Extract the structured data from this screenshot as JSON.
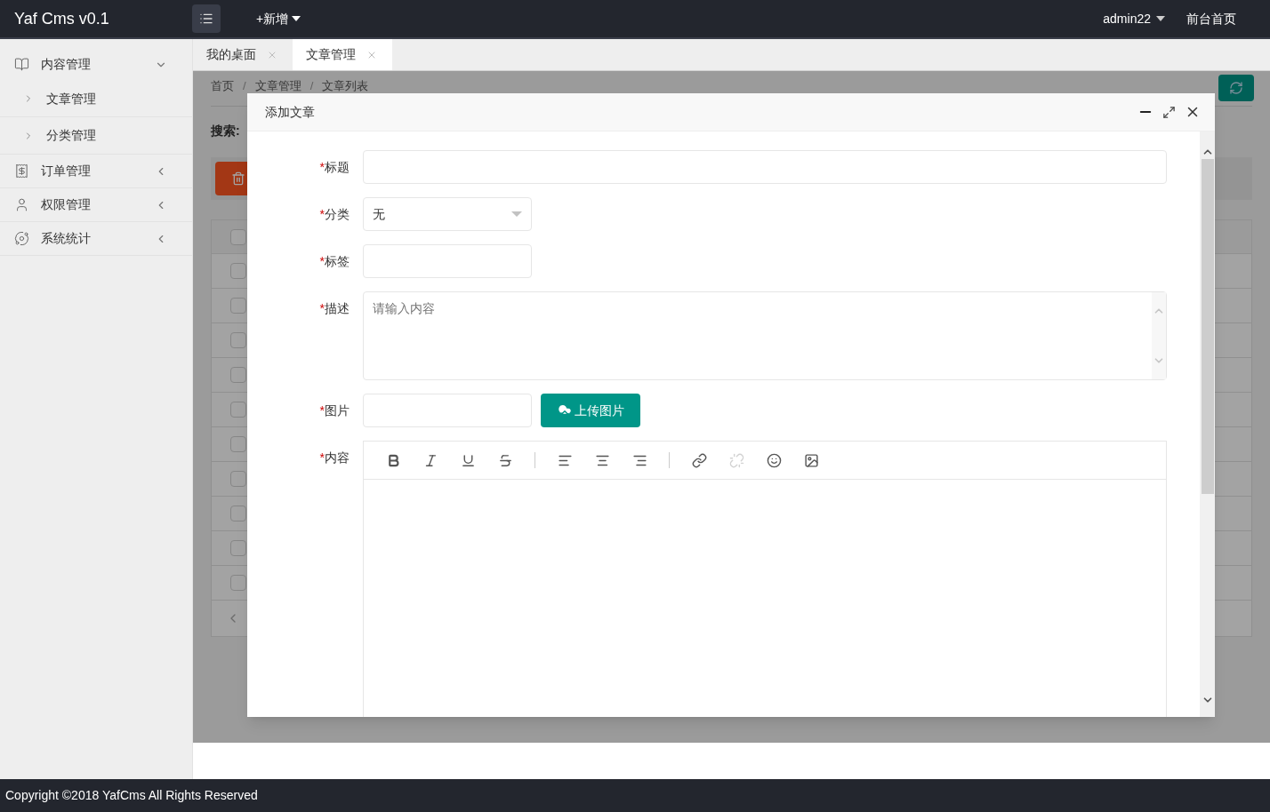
{
  "header": {
    "logo": "Yaf Cms v0.1",
    "new_menu": "+新增",
    "user": "admin22",
    "home_link": "前台首页"
  },
  "sidebar": {
    "items": [
      {
        "label": "内容管理",
        "expanded": true,
        "children": [
          {
            "label": "文章管理"
          },
          {
            "label": "分类管理"
          }
        ]
      },
      {
        "label": "订单管理",
        "expanded": false
      },
      {
        "label": "权限管理",
        "expanded": false
      },
      {
        "label": "系统统计",
        "expanded": false
      }
    ]
  },
  "tabs": [
    {
      "label": "我的桌面",
      "selected": false
    },
    {
      "label": "文章管理",
      "selected": true
    }
  ],
  "page": {
    "breadcrumb": [
      {
        "kind": "link",
        "text": "首页"
      },
      {
        "kind": "sep",
        "text": "/"
      },
      {
        "kind": "link",
        "text": "文章管理"
      },
      {
        "kind": "sep",
        "text": "/"
      },
      {
        "kind": "link",
        "text": "文章列表"
      }
    ],
    "search_label": "搜索:",
    "table": {
      "header_checked": false,
      "rows": [
        {
          "checked": false
        },
        {
          "checked": false
        },
        {
          "checked": false
        },
        {
          "checked": false
        },
        {
          "checked": false
        },
        {
          "checked": false
        },
        {
          "checked": false
        },
        {
          "checked": false
        },
        {
          "checked": false
        },
        {
          "checked": false
        }
      ]
    }
  },
  "dialog": {
    "title": "添加文章",
    "fields": [
      {
        "kind": "text",
        "label": "标题",
        "required_mark": "*"
      },
      {
        "kind": "select",
        "label": "分类",
        "required_mark": "*",
        "value": "无"
      },
      {
        "kind": "short",
        "label": "标签",
        "required_mark": "*"
      },
      {
        "kind": "textarea",
        "label": "描述",
        "required_mark": "*",
        "placeholder": "请输入内容"
      },
      {
        "kind": "upload",
        "label": "图片",
        "required_mark": "*",
        "button": "上传图片"
      },
      {
        "kind": "editor",
        "label": "内容",
        "required_mark": "*"
      }
    ],
    "toolbar": [
      {
        "kind": "bold",
        "disabled": false
      },
      {
        "kind": "italic",
        "disabled": false
      },
      {
        "kind": "underline",
        "disabled": false
      },
      {
        "kind": "strike",
        "disabled": false
      },
      {
        "kind": "sep"
      },
      {
        "kind": "align-left",
        "disabled": false
      },
      {
        "kind": "align-center",
        "disabled": false
      },
      {
        "kind": "align-right",
        "disabled": false
      },
      {
        "kind": "sep"
      },
      {
        "kind": "link",
        "disabled": false
      },
      {
        "kind": "unlink",
        "disabled": true
      },
      {
        "kind": "emoji",
        "disabled": false
      },
      {
        "kind": "image",
        "disabled": false
      }
    ]
  },
  "footer": {
    "copyright": "Copyright ©2018 YafCms All Rights Reserved"
  }
}
